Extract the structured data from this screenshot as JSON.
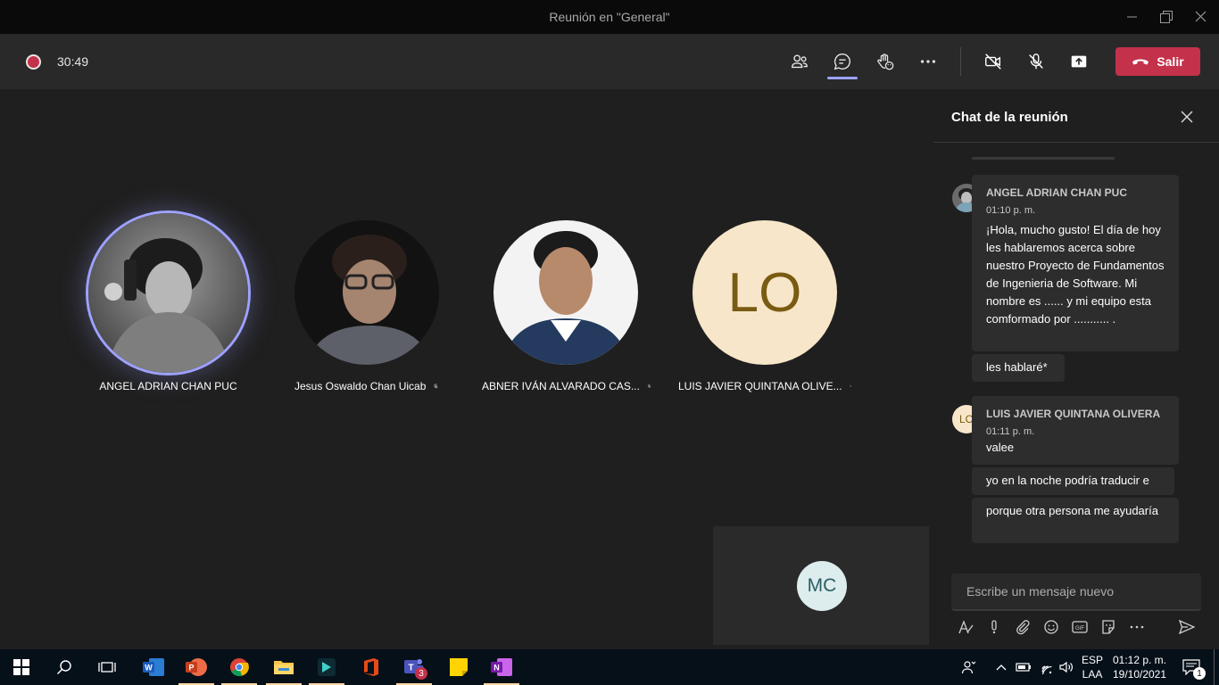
{
  "window": {
    "title": "Reunión en \"General\""
  },
  "toolbar": {
    "timer": "30:49",
    "leave_label": "Salir"
  },
  "participants": [
    {
      "name": "ANGEL ADRIAN CHAN PUC",
      "muted": false,
      "speaking": true
    },
    {
      "name": "Jesus Oswaldo Chan Uicab",
      "muted": true
    },
    {
      "name": "ABNER IVÁN ALVARADO CAS...",
      "muted": true
    },
    {
      "name": "LUIS JAVIER QUINTANA OLIVE...",
      "initials": "LO",
      "muted": true
    }
  ],
  "self_tile": {
    "initials": "MC"
  },
  "chat": {
    "title": "Chat de la reunión",
    "messages": [
      {
        "author": "ANGEL ADRIAN CHAN PUC",
        "time": "01:10 p. m.",
        "text1": "¡Hola, mucho gusto! El día de hoy les hablaremos acerca sobre nuestro Proyecto de Fundamentos de Ingenieria de Software. Mi nombre es ...... y mi equipo esta comformado por ........... .",
        "text2": "les hablaré*"
      },
      {
        "author": "LUIS JAVIER QUINTANA OLIVERA",
        "initials": "LO",
        "time": "01:11 p. m.",
        "text1": "valee",
        "text2": "yo en la noche podría traducir e",
        "text3": "porque otra persona me ayudaría"
      }
    ],
    "compose_placeholder": "Escribe un mensaje nuevo"
  },
  "taskbar": {
    "lang_top": "ESP",
    "lang_bottom": "LAA",
    "time": "01:12 p. m.",
    "date": "19/10/2021",
    "teams_badge": "3",
    "notif_count": "1"
  },
  "colors": {
    "accent": "#9ea2ff",
    "leave": "#c4314b",
    "taskbar": "#061019"
  }
}
